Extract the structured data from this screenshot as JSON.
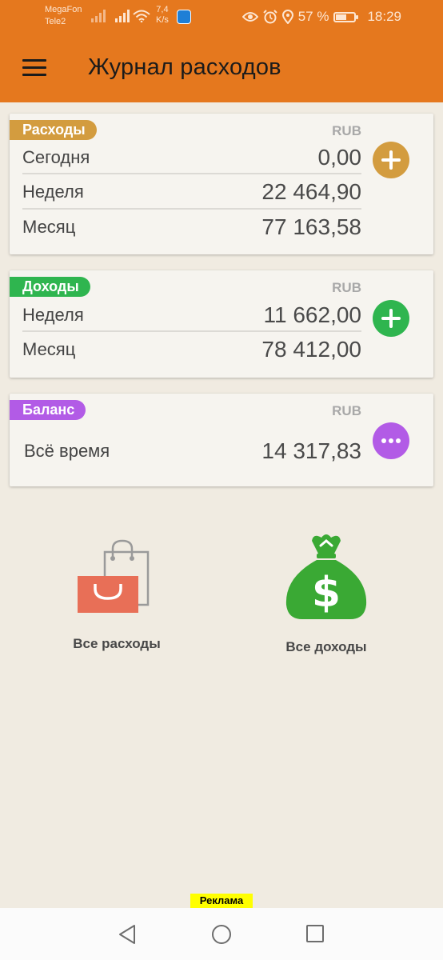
{
  "status_bar": {
    "carrier1": "MegaFon",
    "carrier2": "Tele2",
    "speed_value": "7,4",
    "speed_unit": "K/s",
    "battery_percent": "57 %",
    "battery_level": 0.57,
    "time": "18:29"
  },
  "app_bar": {
    "title": "Журнал расходов"
  },
  "expenses": {
    "tag": "Расходы",
    "currency": "RUB",
    "rows": [
      {
        "label": "Сегодня",
        "value": "0,00"
      },
      {
        "label": "Неделя",
        "value": "22 464,90"
      },
      {
        "label": "Месяц",
        "value": "77 163,58"
      }
    ]
  },
  "income": {
    "tag": "Доходы",
    "currency": "RUB",
    "rows": [
      {
        "label": "Неделя",
        "value": "11 662,00"
      },
      {
        "label": "Месяц",
        "value": "78 412,00"
      }
    ]
  },
  "balance": {
    "tag": "Баланс",
    "currency": "RUB",
    "rows": [
      {
        "label": "Всё время",
        "value": "14 317,83"
      }
    ]
  },
  "shortcuts": {
    "all_expenses": "Все расходы",
    "all_income": "Все доходы"
  },
  "ad_label": "Реклама",
  "colors": {
    "app_bar": "#e5781e",
    "expenses": "#d39c3f",
    "income": "#2fb54f",
    "balance": "#b25be6",
    "background": "#f0ebe1"
  }
}
